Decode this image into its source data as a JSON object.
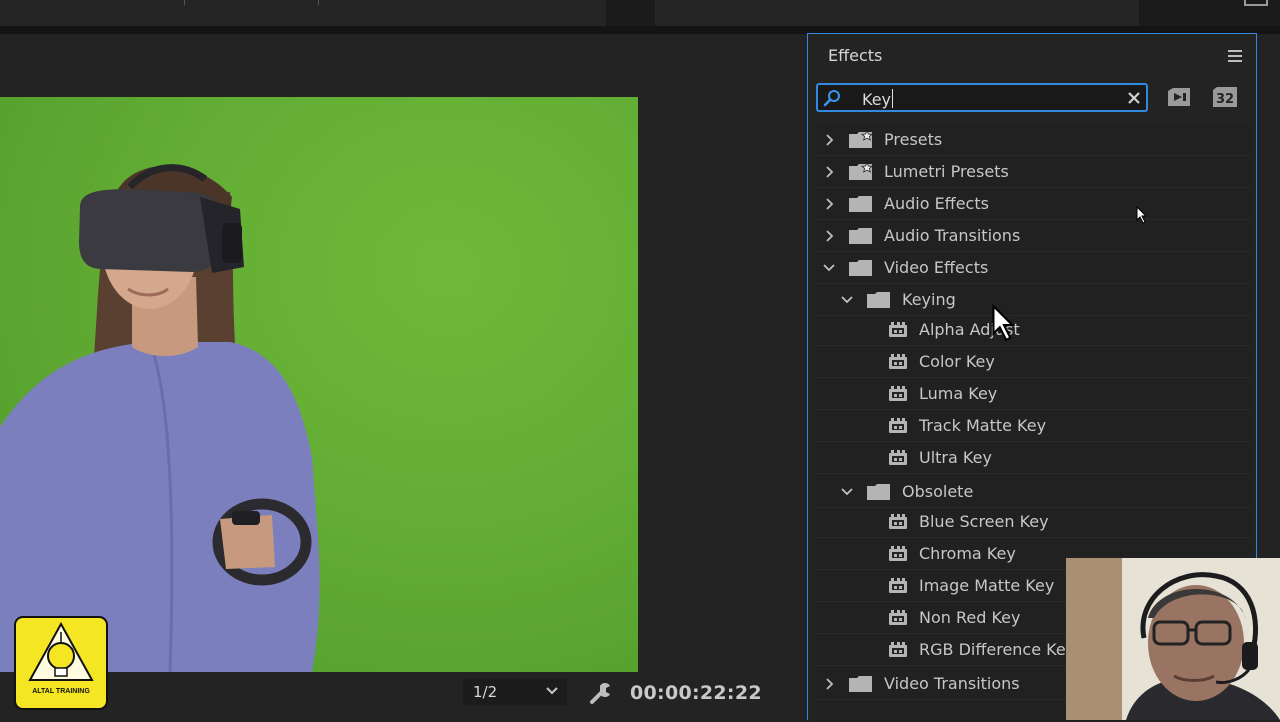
{
  "effects_panel": {
    "title": "Effects",
    "search": {
      "value": "Key"
    },
    "toolbar": [
      {
        "icon": "accelerated-effects-icon"
      },
      {
        "icon": "32-bit-color-icon",
        "label": "32"
      }
    ],
    "tree": [
      {
        "label": "Presets",
        "type": "preset-folder",
        "expanded": false
      },
      {
        "label": "Lumetri Presets",
        "type": "preset-folder",
        "expanded": false
      },
      {
        "label": "Audio Effects",
        "type": "folder",
        "expanded": false
      },
      {
        "label": "Audio Transitions",
        "type": "folder",
        "expanded": false
      },
      {
        "label": "Video Effects",
        "type": "folder",
        "expanded": true
      },
      {
        "label": "Keying",
        "type": "folder",
        "expanded": true
      },
      {
        "label": "Alpha Adjust",
        "type": "effect"
      },
      {
        "label": "Color Key",
        "type": "effect"
      },
      {
        "label": "Luma Key",
        "type": "effect"
      },
      {
        "label": "Track Matte Key",
        "type": "effect"
      },
      {
        "label": "Ultra Key",
        "type": "effect"
      },
      {
        "label": "Obsolete",
        "type": "folder",
        "expanded": true
      },
      {
        "label": "Blue Screen Key",
        "type": "effect"
      },
      {
        "label": "Chroma Key",
        "type": "effect"
      },
      {
        "label": "Image Matte Key",
        "type": "effect"
      },
      {
        "label": "Non Red Key",
        "type": "effect"
      },
      {
        "label": "RGB Difference Key",
        "type": "effect"
      },
      {
        "label": "Video Transitions",
        "type": "folder",
        "expanded": false
      }
    ]
  },
  "program_monitor": {
    "resolution": "1/2",
    "timecode": "00:00:22:22"
  },
  "logo": {
    "text": "ALTAL TRAINING"
  },
  "colors": {
    "accent": "#2f8ae0",
    "panel_bg": "#232323",
    "green_screen": "#63ad35"
  }
}
